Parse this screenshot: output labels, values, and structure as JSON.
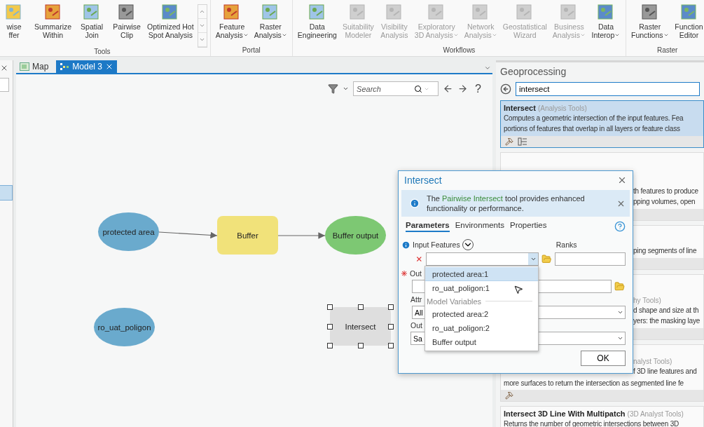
{
  "ribbon": {
    "groups": [
      {
        "label": "Tools",
        "gallery": true,
        "items": [
          {
            "lines": [
              "wise",
              "ffer"
            ],
            "menu": false,
            "disabled": false
          },
          {
            "lines": [
              "Summarize",
              "Within"
            ],
            "menu": false,
            "disabled": false
          },
          {
            "lines": [
              "Spatial",
              "Join"
            ],
            "menu": false,
            "disabled": false
          },
          {
            "lines": [
              "Pairwise",
              "Clip"
            ],
            "menu": false,
            "disabled": false
          },
          {
            "lines": [
              "Optimized Hot",
              "Spot Analysis"
            ],
            "menu": false,
            "disabled": false
          }
        ]
      },
      {
        "label": "Portal",
        "gallery": false,
        "items": [
          {
            "lines": [
              "Feature",
              "Analysis"
            ],
            "menu": true,
            "disabled": false
          },
          {
            "lines": [
              "Raster",
              "Analysis"
            ],
            "menu": true,
            "disabled": false
          }
        ]
      },
      {
        "label": "Workflows",
        "gallery": false,
        "items": [
          {
            "lines": [
              "Data",
              "Engineering"
            ],
            "menu": false,
            "disabled": false
          },
          {
            "lines": [
              "Suitability",
              "Modeler"
            ],
            "menu": false,
            "disabled": true
          },
          {
            "lines": [
              "Visibility",
              "Analysis"
            ],
            "menu": false,
            "disabled": true
          },
          {
            "lines": [
              "Exploratory",
              "3D Analysis"
            ],
            "menu": true,
            "disabled": true
          },
          {
            "lines": [
              "Network",
              "Analysis"
            ],
            "menu": true,
            "disabled": true
          },
          {
            "lines": [
              "Geostatistical",
              "Wizard"
            ],
            "menu": false,
            "disabled": true
          },
          {
            "lines": [
              "Business",
              "Analysis"
            ],
            "menu": true,
            "disabled": true
          },
          {
            "lines": [
              "Data",
              "Interop"
            ],
            "menu": true,
            "disabled": false
          }
        ]
      },
      {
        "label": "Raster",
        "gallery": false,
        "items": [
          {
            "lines": [
              "Raster",
              "Functions"
            ],
            "menu": true,
            "disabled": false
          },
          {
            "lines": [
              "Function",
              "Editor"
            ],
            "menu": false,
            "disabled": false
          }
        ]
      }
    ]
  },
  "document_tabs": [
    {
      "label": "Map",
      "selected": false,
      "closable": false
    },
    {
      "label": "Model 3",
      "selected": true,
      "closable": true
    }
  ],
  "model_toolbar": {
    "search_placeholder": "Search",
    "help": "?"
  },
  "model": {
    "nodes": [
      {
        "label": "protected area",
        "kind": "data",
        "selected": false
      },
      {
        "label": "Buffer",
        "kind": "tool",
        "ready": true,
        "selected": false
      },
      {
        "label": "Buffer output",
        "kind": "output",
        "selected": false
      },
      {
        "label": "ro_uat_poligon",
        "kind": "data",
        "selected": false
      },
      {
        "label": "Intersect",
        "kind": "tool",
        "ready": false,
        "selected": true
      }
    ]
  },
  "geoprocessing": {
    "title": "Geoprocessing",
    "search_value": "intersect",
    "results": [
      {
        "kind": "full",
        "selected": true,
        "title": "Intersect",
        "toolbox": "(Analysis Tools)",
        "lines": [
          "Computes a geometric intersection of the input features. Fea",
          "portions of features that overlap in all layers or feature class"
        ]
      },
      {
        "kind": "covered",
        "selected": false,
        "lines": [
          "th features to produce",
          "pping volumes, open"
        ]
      },
      {
        "kind": "covered",
        "selected": false,
        "lines": [
          "ping segments of line"
        ]
      },
      {
        "kind": "covered",
        "selected": false,
        "toolbox": "hy Tools)",
        "lines": [
          "d shape and size at th",
          "yers: the masking laye"
        ]
      },
      {
        "kind": "covered",
        "selected": false,
        "toolbox": "nalyst Tools)",
        "lines": [
          "f 3D line features and"
        ],
        "tail": "more surfaces to return the intersection as segmented line fe"
      },
      {
        "kind": "full",
        "selected": false,
        "title": "Intersect 3D Line With Multipatch",
        "toolbox": "(3D Analyst Tools)",
        "lines": [
          "Returns the number of geometric intersections between 3D"
        ]
      }
    ]
  },
  "dialog": {
    "title": "Intersect",
    "notice": {
      "before": "The ",
      "link": "Pairwise Intersect",
      "after": " tool provides enhanced functionality or performance."
    },
    "tabs": [
      {
        "label": "Parameters",
        "selected": true
      },
      {
        "label": "Environments",
        "selected": false
      },
      {
        "label": "Properties",
        "selected": false
      }
    ],
    "input_label": "Input Features",
    "ranks_label": "Ranks",
    "output_label": "Out",
    "attributes_label": "Attr",
    "attributes_value": "All",
    "output_type_label": "Out",
    "output_type_value": "Sa",
    "ok": "OK",
    "dropdown": {
      "items": [
        {
          "label": "protected area:1",
          "kind": "option",
          "selected": true
        },
        {
          "label": "ro_uat_poligon:1",
          "kind": "option",
          "selected": false
        },
        {
          "label": "Model Variables",
          "kind": "header"
        },
        {
          "label": "protected area:2",
          "kind": "option",
          "selected": false
        },
        {
          "label": "ro_uat_poligon:2",
          "kind": "option",
          "selected": false
        },
        {
          "label": "Buffer output",
          "kind": "option",
          "selected": false
        }
      ]
    }
  }
}
